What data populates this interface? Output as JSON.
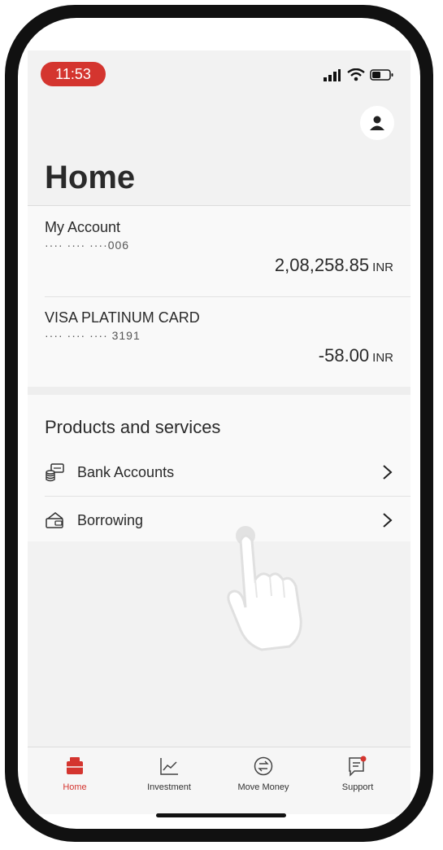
{
  "status_bar": {
    "time": "11:53",
    "icons": [
      "signal-icon",
      "wifi-icon",
      "battery-icon"
    ]
  },
  "header": {
    "title": "Home",
    "profile_icon": "person-icon"
  },
  "accounts": [
    {
      "name": "My Account",
      "masked_number": "···· ···· ····006",
      "balance": "2,08,258.85",
      "currency": "INR"
    },
    {
      "name": "VISA PLATINUM CARD",
      "masked_number": "···· ···· ···· 3191",
      "balance": "-58.00",
      "currency": "INR"
    }
  ],
  "products": {
    "heading": "Products and services",
    "items": [
      {
        "label": "Bank Accounts",
        "icon": "bank-accounts-icon"
      },
      {
        "label": "Borrowing",
        "icon": "borrowing-icon"
      }
    ]
  },
  "tabbar": {
    "items": [
      {
        "label": "Home",
        "icon": "wallet-icon",
        "active": true
      },
      {
        "label": "Investment",
        "icon": "chart-icon",
        "active": false
      },
      {
        "label": "Move Money",
        "icon": "transfer-icon",
        "active": false
      },
      {
        "label": "Support",
        "icon": "chat-icon",
        "active": false
      }
    ]
  },
  "colors": {
    "accent": "#d4352f",
    "background": "#f2f2f2",
    "text": "#2a2a2a"
  }
}
